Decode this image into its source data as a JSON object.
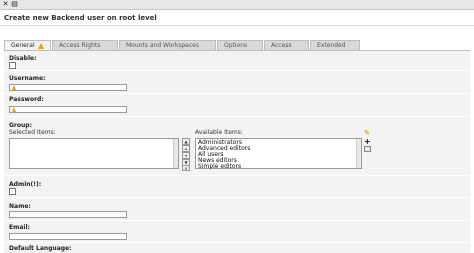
{
  "toolbar": {
    "icons": [
      {
        "name": "close-icon",
        "glyph": "✕"
      },
      {
        "name": "list-icon",
        "glyph": "▤"
      }
    ]
  },
  "page": {
    "title": "Create new Backend user on root level"
  },
  "tabs": [
    {
      "label": "General",
      "active": true,
      "warning": true
    },
    {
      "label": "Access Rights",
      "active": false
    },
    {
      "label": "Mounts and Workspaces",
      "active": false
    },
    {
      "label": "Options",
      "active": false
    },
    {
      "label": "Access",
      "active": false
    },
    {
      "label": "Extended",
      "active": false
    }
  ],
  "form": {
    "disable_label": "Disable:",
    "username_label": "Username:",
    "password_label": "Password:",
    "group_label": "Group:",
    "selected_items_label": "Selected Items:",
    "available_items_label": "Available Items:",
    "available_items": [
      "Administrators",
      "Advanced editors",
      "All users",
      "News editors",
      "Simple editors"
    ],
    "admin_label": "Admin(!):",
    "name_label": "Name:",
    "email_label": "Email:",
    "default_language_label": "Default Language:"
  },
  "colors": {
    "warning": "#e8a000",
    "tab_active_bg": "#f3f3f3",
    "tab_bg": "#d9d9d9",
    "panel_bg": "#f3f3f3"
  }
}
